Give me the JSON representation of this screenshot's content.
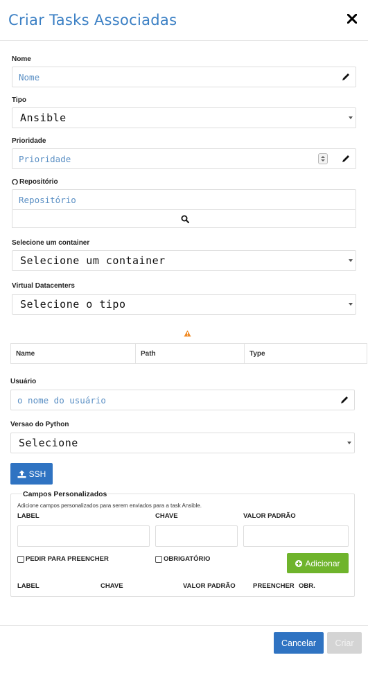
{
  "modal": {
    "title": "Criar Tasks Associadas",
    "close_label": "✕"
  },
  "form": {
    "nome": {
      "label": "Nome",
      "placeholder": "Nome"
    },
    "tipo": {
      "label": "Tipo",
      "value": "Ansible"
    },
    "prioridade": {
      "label": "Prioridade",
      "placeholder": "Prioridade"
    },
    "repositorio": {
      "label": "Repositório",
      "placeholder": "Repositório",
      "icon": "github-icon",
      "search_icon": "search-icon"
    },
    "container": {
      "label": "Selecione um container",
      "value": "Selecione um container"
    },
    "virtual_datacenters": {
      "label": "Virtual Datacenters",
      "value": "Selecione o tipo"
    },
    "warning_icon": "warning-icon",
    "vdc_table": {
      "columns": [
        "Name",
        "Path",
        "Type"
      ]
    },
    "usuario": {
      "label": "Usuário",
      "placeholder": "o nome do usuário"
    },
    "python": {
      "label": "Versao do Python",
      "value": "Selecione"
    },
    "ssh_button": "SSH"
  },
  "custom_fields": {
    "legend": "Campos Personalizados",
    "hint": "Adicione campos personalizados para serem enviados para a task Ansible.",
    "label_col": "LABEL",
    "chave_col": "CHAVE",
    "valor_col": "VALOR PADRÃO",
    "pedir_label": "PEDIR PARA PREENCHER",
    "obrigatorio_label": "OBRIGATÓRIO",
    "add_button": "Adicionar",
    "table_columns": [
      "LABEL",
      "CHAVE",
      "VALOR PADRÃO",
      "PREENCHER",
      "OBR."
    ]
  },
  "footer": {
    "cancel": "Cancelar",
    "create": "Criar"
  },
  "colors": {
    "title": "#3a7fc4",
    "primary": "#2f73c2",
    "success": "#6fb42c",
    "warning": "#f08a24",
    "disabled": "#d4d4d4"
  }
}
